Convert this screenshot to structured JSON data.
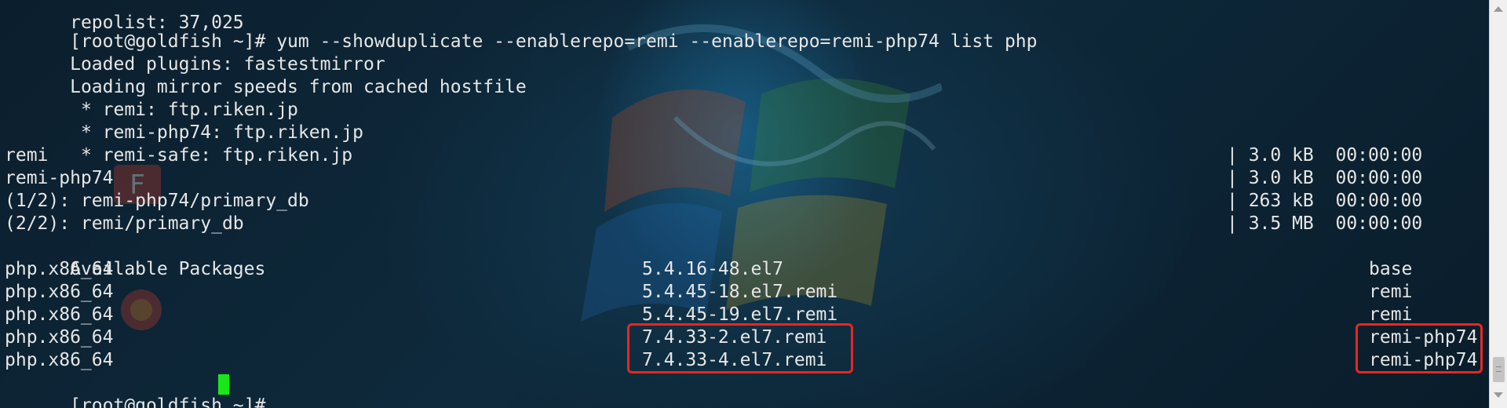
{
  "terminal": {
    "top_partial": "repolist: 37,025",
    "command_prompt": "[root@goldfish ~]# ",
    "command": "yum --showduplicate --enablerepo=remi --enablerepo=remi-php74 list php",
    "loaded_plugins": "Loaded plugins: fastestmirror",
    "loading_mirror": "Loading mirror speeds from cached hostfile",
    "mirrors": [
      " * remi: ftp.riken.jp",
      " * remi-php74: ftp.riken.jp",
      " * remi-safe: ftp.riken.jp"
    ],
    "downloads": [
      {
        "name": "remi",
        "size": "| 3.0 kB  00:00:00"
      },
      {
        "name": "remi-php74",
        "size": "| 3.0 kB  00:00:00"
      },
      {
        "name": "(1/2): remi-php74/primary_db",
        "size": "| 263 kB  00:00:00"
      },
      {
        "name": "(2/2): remi/primary_db",
        "size": "| 3.5 MB  00:00:00"
      }
    ],
    "available_header": "Available Packages",
    "packages": [
      {
        "name": "php.x86_64",
        "version": "5.4.16-48.el7",
        "repo": "base"
      },
      {
        "name": "php.x86_64",
        "version": "5.4.45-18.el7.remi",
        "repo": "remi"
      },
      {
        "name": "php.x86_64",
        "version": "5.4.45-19.el7.remi",
        "repo": "remi"
      },
      {
        "name": "php.x86_64",
        "version": "7.4.33-2.el7.remi",
        "repo": "remi-php74"
      },
      {
        "name": "php.x86_64",
        "version": "7.4.33-4.el7.remi",
        "repo": "remi-php74"
      }
    ],
    "final_prompt": "[root@goldfish ~]# "
  },
  "colors": {
    "text": "#e6e6e6",
    "cursor": "#18e818",
    "highlight_box": "#e8271f",
    "background": "#0b1e2d"
  }
}
